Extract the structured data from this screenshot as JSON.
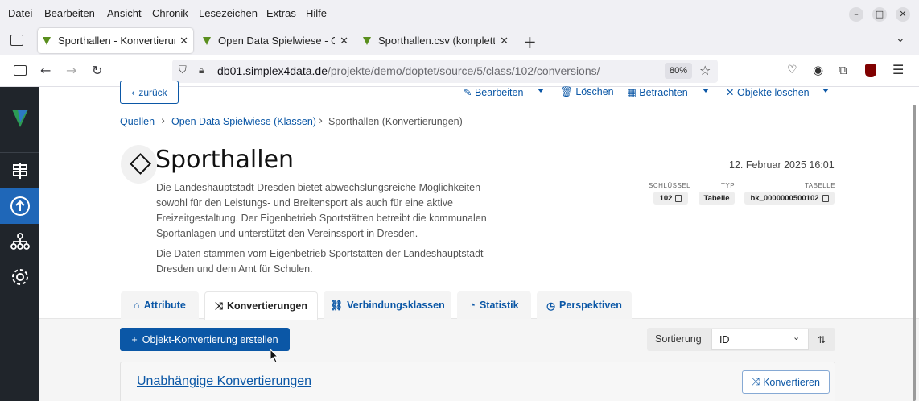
{
  "browser": {
    "menu": [
      "Datei",
      "Bearbeiten",
      "Ansicht",
      "Chronik",
      "Lesezeichen",
      "Extras",
      "Hilfe"
    ],
    "tabs": [
      {
        "title": "Sporthallen - Konvertierun"
      },
      {
        "title": "Open Data Spielwiese - Q"
      },
      {
        "title": "Sporthallen.csv (komplett"
      }
    ],
    "url_host": "db01.simplex4data.de",
    "url_path": "/projekte/demo/doptet/source/5/class/102/conversions/",
    "zoom": "80%"
  },
  "actions": {
    "back": "zurück",
    "edit": "Bearbeiten",
    "delete": "Löschen",
    "view": "Betrachten",
    "delete_objects": "Objekte löschen"
  },
  "breadcrumb": {
    "sources": "Quellen",
    "parent": "Open Data Spielwiese (Klassen)",
    "current": "Sporthallen (Konvertierungen)"
  },
  "header": {
    "title": "Sporthallen",
    "date": "12. Februar 2025 16:01"
  },
  "description": {
    "p1": "Die Landeshauptstadt Dresden bietet abwechslungsreiche Möglichkeiten sowohl für den Leistungs- und Breitensport als auch für eine aktive Freizeitgestaltung. Der Eigenbetrieb Sportstätten betreibt die kommunalen Sportanlagen und unterstützt den Vereinssport in Dresden.",
    "p2": "Die Daten stammen vom Eigenbetrieb Sportstätten der Landeshauptstadt Dresden und dem Amt für Schulen."
  },
  "meta": {
    "key_label": "SCHLÜSSEL",
    "key_value": "102",
    "type_label": "TYP",
    "type_value": "Tabelle",
    "table_label": "TABELLE",
    "table_value": "bk_0000000500102"
  },
  "content_tabs": [
    "Attribute",
    "Konvertierungen",
    "Verbindungsklassen",
    "Statistik",
    "Perspektiven"
  ],
  "toolbar": {
    "create": "Objekt-Konvertierung erstellen",
    "sort_label": "Sortierung",
    "sort_value": "ID"
  },
  "card": {
    "title": "Unabhängige Konvertierungen",
    "convert": "Konvertieren"
  }
}
